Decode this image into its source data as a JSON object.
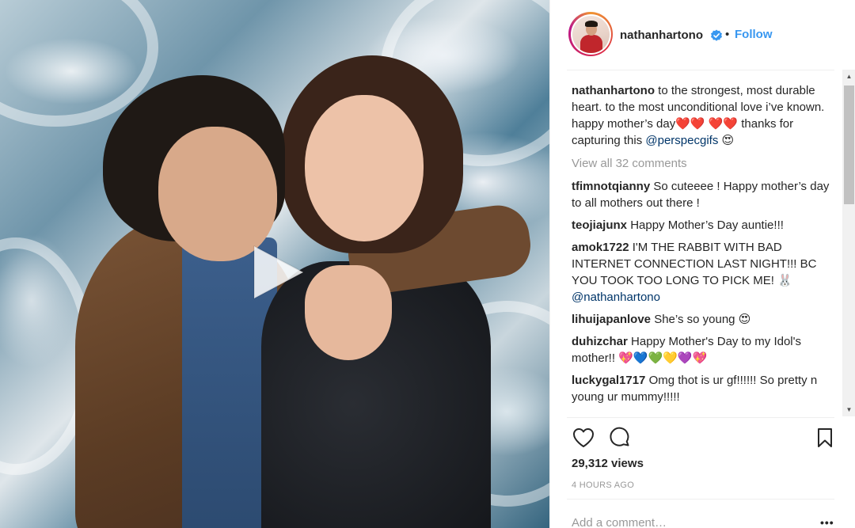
{
  "post": {
    "author": "nathanhartono",
    "follow_label": "Follow",
    "separator": "•"
  },
  "caption": {
    "user": "nathanhartono",
    "text_1": "to the strongest, most durable heart. to the most unconditional love i’ve known. happy mother’s day",
    "hearts_1": "❤️❤️",
    "hearts_2": "❤️❤️",
    "text_2": "thanks for capturing this",
    "mention": "@perspecgifs",
    "emoji_end": "😍"
  },
  "view_all_comments": "View all 32 comments",
  "comments": [
    {
      "user": "tfimnotqianny",
      "text": "So cuteeee ! Happy mother’s day to all mothers out there !"
    },
    {
      "user": "teojiajunx",
      "text": "Happy Mother’s Day auntie!!!"
    },
    {
      "user": "amok1722",
      "text": "I'M THE RABBIT WITH BAD INTERNET CONNECTION LAST NIGHT!!! BC YOU TOOK TOO LONG TO PICK ME!",
      "emoji": "🐰",
      "mention": "@nathanhartono"
    },
    {
      "user": "lihuijapanlove",
      "text": "She’s so young",
      "emoji": "😍"
    },
    {
      "user": "duhizchar",
      "text": "Happy Mother's Day to my Idol's mother!!",
      "emoji": "💖💙💚💛💜💖"
    },
    {
      "user": "luckygal1717",
      "text": "Omg thot is ur gf!!!!!! So pretty n young ur mummy!!!!!"
    }
  ],
  "views": "29,312 views",
  "time_ago": "4 HOURS AGO",
  "add_comment_placeholder": "Add a comment…",
  "more_label": "•••",
  "colors": {
    "link_blue": "#3897f0",
    "mention_blue": "#003569",
    "muted_gray": "#999999",
    "text": "#262626"
  },
  "icons": [
    "play-icon",
    "verified-badge-icon",
    "heart-icon",
    "comment-icon",
    "bookmark-icon",
    "more-icon"
  ]
}
